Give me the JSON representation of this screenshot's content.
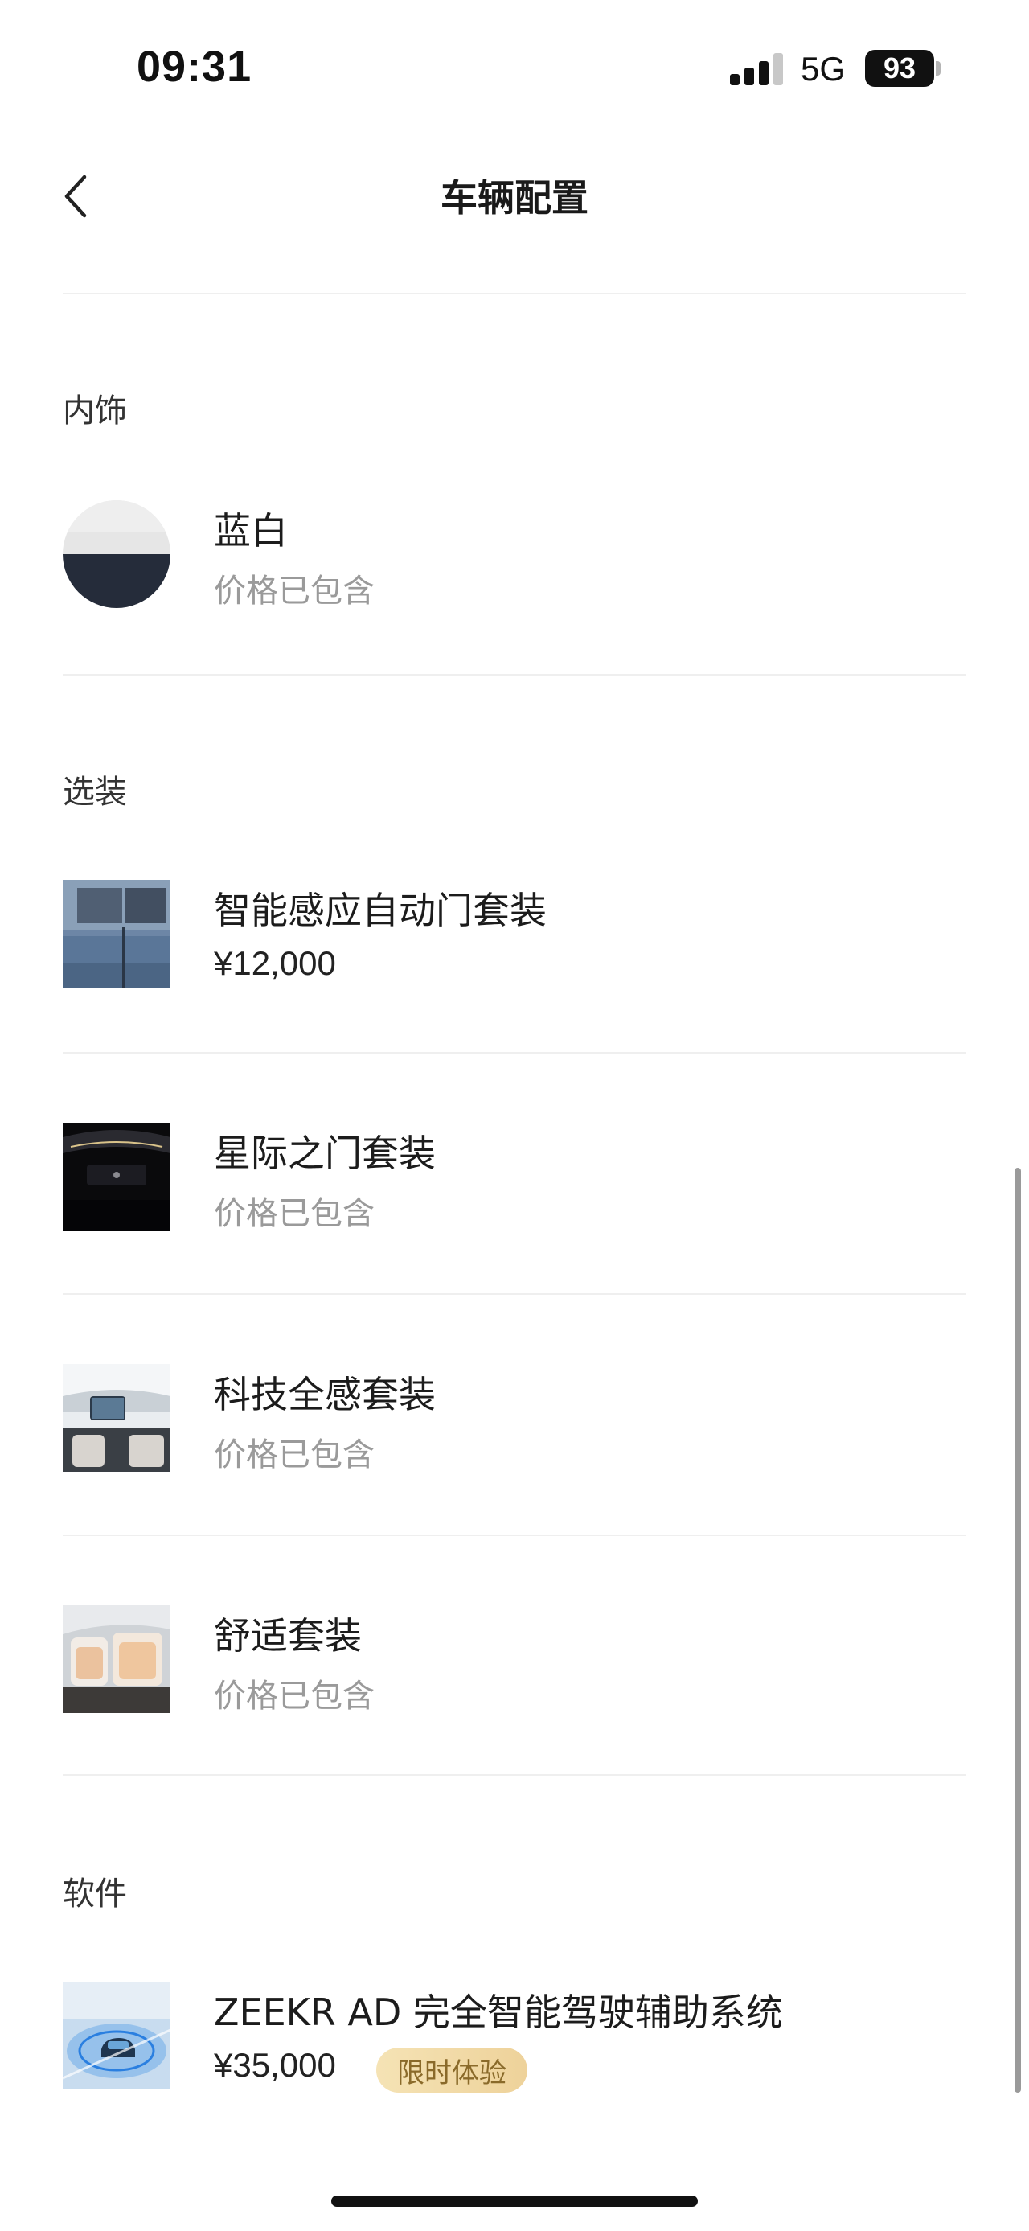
{
  "status_bar": {
    "time": "09:31",
    "network": "5G",
    "battery": "93"
  },
  "nav": {
    "title": "车辆配置",
    "back_icon": "chevron-left-icon"
  },
  "interior": {
    "title": "内饰",
    "item": {
      "name": "蓝白",
      "sub": "价格已包含",
      "swatch_top": "#e6e6e6",
      "swatch_bottom": "#252c3a"
    }
  },
  "options": {
    "title": "选装",
    "items": [
      {
        "name": "智能感应自动门套装",
        "price": "¥12,000"
      },
      {
        "name": "星际之门套装",
        "sub": "价格已包含"
      },
      {
        "name": "科技全感套装",
        "sub": "价格已包含"
      },
      {
        "name": "舒适套装",
        "sub": "价格已包含"
      }
    ]
  },
  "software": {
    "title": "软件",
    "item": {
      "name": "ZEEKR AD 完全智能驾驶辅助系统",
      "price": "¥35,000",
      "badge": "限时体验"
    }
  }
}
